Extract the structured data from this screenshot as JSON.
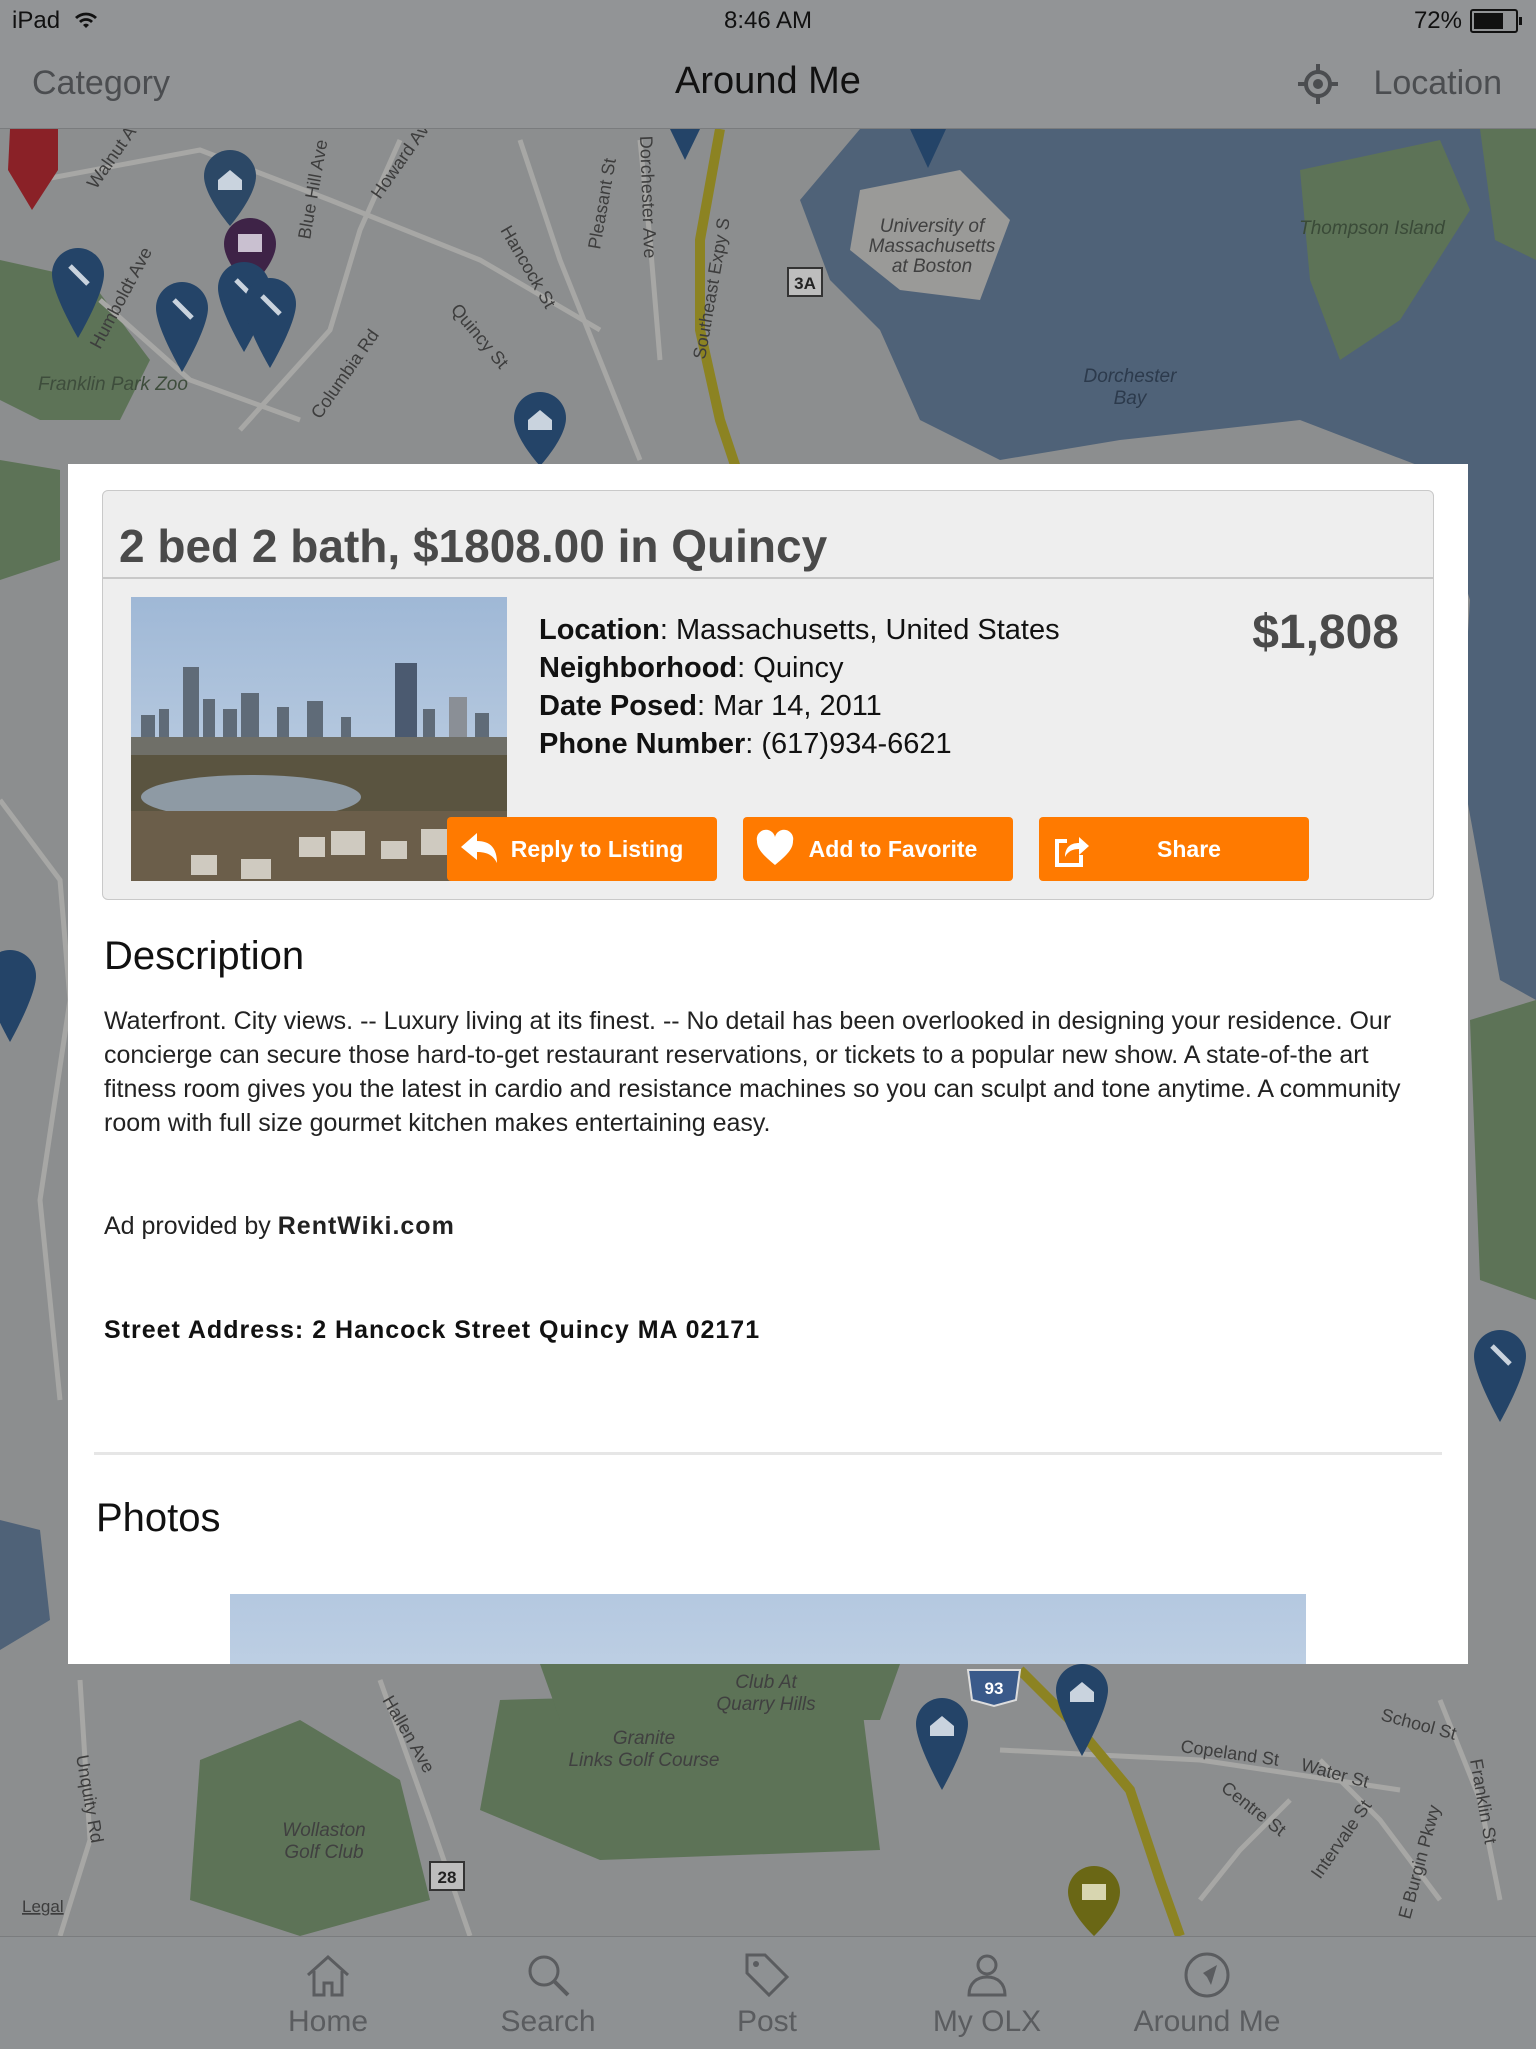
{
  "status_bar": {
    "device": "iPad",
    "time": "8:46 AM",
    "battery": "72%",
    "battery_level": 0.72
  },
  "nav": {
    "left": "Category",
    "title": "Around Me",
    "right": "Location"
  },
  "map": {
    "labels": {
      "franklin_park_zoo": "Franklin Park Zoo",
      "umass_1": "University of",
      "umass_2": "Massachusetts",
      "umass_3": "at Boston",
      "thompson_island": "Thompson Island",
      "dorchester_bay_1": "Dorchester",
      "dorchester_bay_2": "Bay",
      "links_club_1": "Club At",
      "links_club_2": "Quarry Hills",
      "granite_1": "Granite",
      "granite_2": "Links Golf Course",
      "wollaston_1": "Wollaston",
      "wollaston_2": "Golf Club",
      "legal": "Legal",
      "route_3a": "3A",
      "route_93": "93",
      "route_28": "28",
      "walnut": "Walnut Ave",
      "humboldt": "Humboldt Ave",
      "bluehill": "Blue Hill Ave",
      "howard": "Howard Ave",
      "hancock": "Hancock St",
      "pleasant": "Pleasant St",
      "dorchester_ave": "Dorchester Ave",
      "southeast": "Southeast Expy S",
      "columbia": "Columbia Rd",
      "quincy_st": "Quincy St",
      "copeland": "Copeland St",
      "water": "Water St",
      "school": "School St",
      "centre": "Centre St",
      "intervale": "Intervale St",
      "hallen": "Hallen Ave",
      "unquity": "Unquity Rd",
      "burgin": "E Burgin Pkwy",
      "franklin_st": "Franklin St"
    }
  },
  "listing": {
    "headline": "2 bed 2 bath, $1808.00 in Quincy",
    "price": "$1,808",
    "location_label": "Location",
    "location": "Massachusetts, United States",
    "neighborhood_label": "Neighborhood",
    "neighborhood": "Quincy",
    "date_label": "Date Posed",
    "date": "Mar 14, 2011",
    "phone_label": "Phone Number",
    "phone": "(617)934-6621",
    "buttons": {
      "reply": "Reply to Listing",
      "favorite": "Add to Favorite",
      "share": "Share"
    },
    "description_title": "Description",
    "description": "Waterfront. City views. -- Luxury living at its finest. -- No detail has been overlooked in designing your residence. Our concierge can secure those hard-to-get restaurant reservations, or tickets to a popular new show. A state-of-the art fitness room gives you the latest in cardio and resistance machines so you can sculpt and tone anytime. A community room with full size gourmet kitchen makes entertaining easy.",
    "ad_by_prefix": "Ad provided by",
    "ad_by_source": "RentWiki.com",
    "street_address": "Street Address: 2 Hancock Street Quincy MA 02171",
    "photos_title": "Photos"
  },
  "tabs": [
    {
      "label": "Home",
      "icon": "home-icon"
    },
    {
      "label": "Search",
      "icon": "search-icon"
    },
    {
      "label": "Post",
      "icon": "tag-icon"
    },
    {
      "label": "My OLX",
      "icon": "person-icon"
    },
    {
      "label": "Around Me",
      "icon": "compass-icon"
    }
  ],
  "colors": {
    "accent": "#ff7a00",
    "overlay": "#929496",
    "pin_blue": "#2c5a8c",
    "pin_red": "#b82b33",
    "pin_purple": "#5c2d6e",
    "pin_olive": "#8d8a1a"
  }
}
